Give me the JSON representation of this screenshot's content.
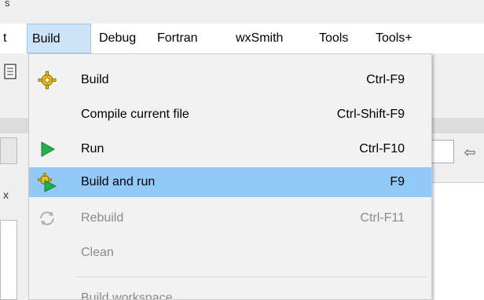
{
  "title_fragment": "s",
  "menubar": {
    "items": [
      {
        "label": "t"
      },
      {
        "label": "Build"
      },
      {
        "label": "Debug"
      },
      {
        "label": "Fortran"
      },
      {
        "label": "wxSmith"
      },
      {
        "label": "Tools"
      },
      {
        "label": "Tools+"
      }
    ],
    "active_index": 1
  },
  "background": {
    "close_glyph": "x",
    "nav_arrow": "⇦"
  },
  "build_menu": {
    "items": [
      {
        "label": "Build",
        "shortcut": "Ctrl-F9",
        "icon": "gear-icon",
        "enabled": true
      },
      {
        "label": "Compile current file",
        "shortcut": "Ctrl-Shift-F9",
        "icon": "",
        "enabled": true
      },
      {
        "label": "Run",
        "shortcut": "Ctrl-F10",
        "icon": "play-icon",
        "enabled": true
      },
      {
        "label": "Build and run",
        "shortcut": "F9",
        "icon": "gear-play-icon",
        "enabled": true,
        "highlighted": true
      },
      {
        "label": "Rebuild",
        "shortcut": "Ctrl-F11",
        "icon": "rebuild-icon",
        "enabled": false
      },
      {
        "label": "Clean",
        "shortcut": "",
        "icon": "",
        "enabled": false
      },
      {
        "label": "Build workspace",
        "shortcut": "",
        "icon": "",
        "enabled": false
      }
    ]
  },
  "colors": {
    "highlight": "#91c9f7",
    "menu_active": "#cce4f7",
    "disabled_text": "#8a8a8a",
    "play_green": "#22b14c",
    "gear_yellow": "#e8c020"
  }
}
